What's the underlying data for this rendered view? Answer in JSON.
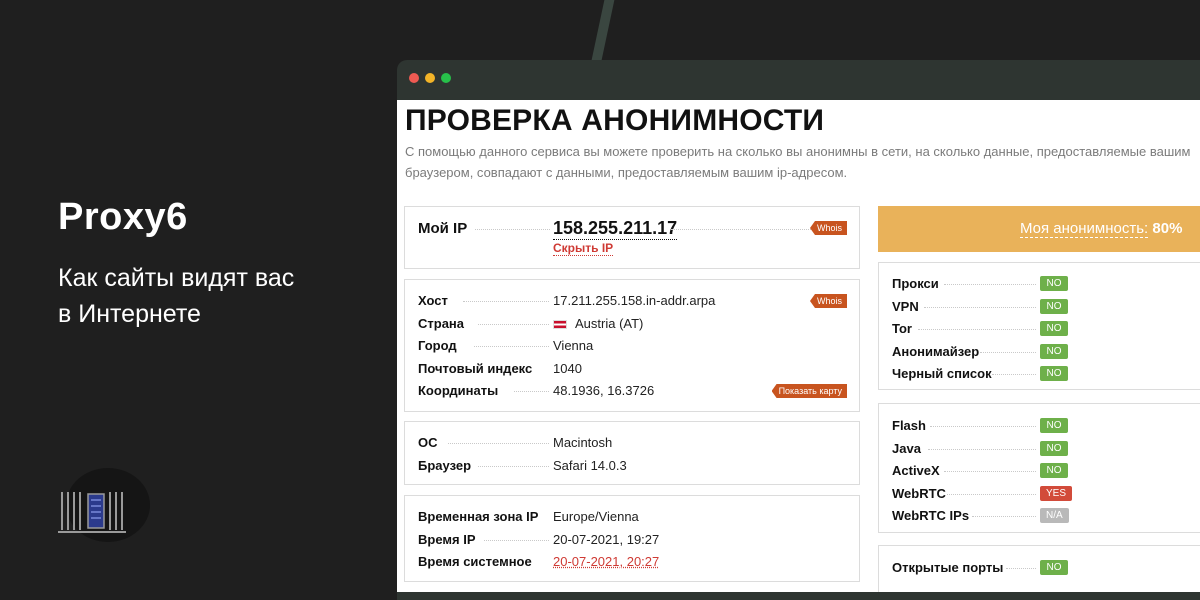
{
  "promo": {
    "brand": "Proxy6",
    "tagline_line1": "Как сайты видят вас",
    "tagline_line2": "в Интернете"
  },
  "page": {
    "title": "ПРОВЕРКА АНОНИМНОСТИ",
    "description": "С помощью данного сервиса вы можете проверить на сколько вы анонимны в сети, на сколько данные, предоставляемые вашим браузером, совпадают с данными, предоставляемым вашим ip-адресом."
  },
  "ip_card": {
    "label": "Мой IP",
    "ip": "158.255.211.17",
    "hide_link": "Скрыть IP",
    "whois": "Whois"
  },
  "geo_card": {
    "whois": "Whois",
    "map_button": "Показать карту",
    "rows": [
      {
        "label": "Хост",
        "value": "17.211.255.158.in-addr.arpa"
      },
      {
        "label": "Страна",
        "value": "Austria (AT)"
      },
      {
        "label": "Город",
        "value": "Vienna"
      },
      {
        "label": "Почтовый индекс",
        "value": "1040"
      },
      {
        "label": "Координаты",
        "value": "48.1936, 16.3726"
      }
    ]
  },
  "system_card": {
    "rows": [
      {
        "label": "ОС",
        "value": "Macintosh"
      },
      {
        "label": "Браузер",
        "value": "Safari 14.0.3"
      }
    ]
  },
  "time_card": {
    "rows": [
      {
        "label": "Временная зона IP",
        "value": "Europe/Vienna"
      },
      {
        "label": "Время IP",
        "value": "20-07-2021, 19:27"
      },
      {
        "label": "Время системное",
        "value": "20-07-2021, 20:27"
      }
    ]
  },
  "anonymity": {
    "label": "Моя анонимность:",
    "percent": "80%"
  },
  "checks_1": [
    {
      "label": "Прокси",
      "status": "NO"
    },
    {
      "label": "VPN",
      "status": "NO"
    },
    {
      "label": "Tor",
      "status": "NO"
    },
    {
      "label": "Анонимайзер",
      "status": "NO"
    },
    {
      "label": "Черный список",
      "status": "NO"
    }
  ],
  "checks_2": [
    {
      "label": "Flash",
      "status": "NO"
    },
    {
      "label": "Java",
      "status": "NO"
    },
    {
      "label": "ActiveX",
      "status": "NO"
    },
    {
      "label": "WebRTC",
      "status": "YES"
    },
    {
      "label": "WebRTC IPs",
      "status": "N/A"
    }
  ],
  "checks_3": [
    {
      "label": "Открытые порты",
      "status": "NO"
    }
  ],
  "colors": {
    "status_no": "#6eb04a",
    "status_yes": "#d24b3a",
    "status_na": "#b9b9b9",
    "anonymity_banner": "#e9b25a",
    "whois_tag": "#c8541f"
  }
}
